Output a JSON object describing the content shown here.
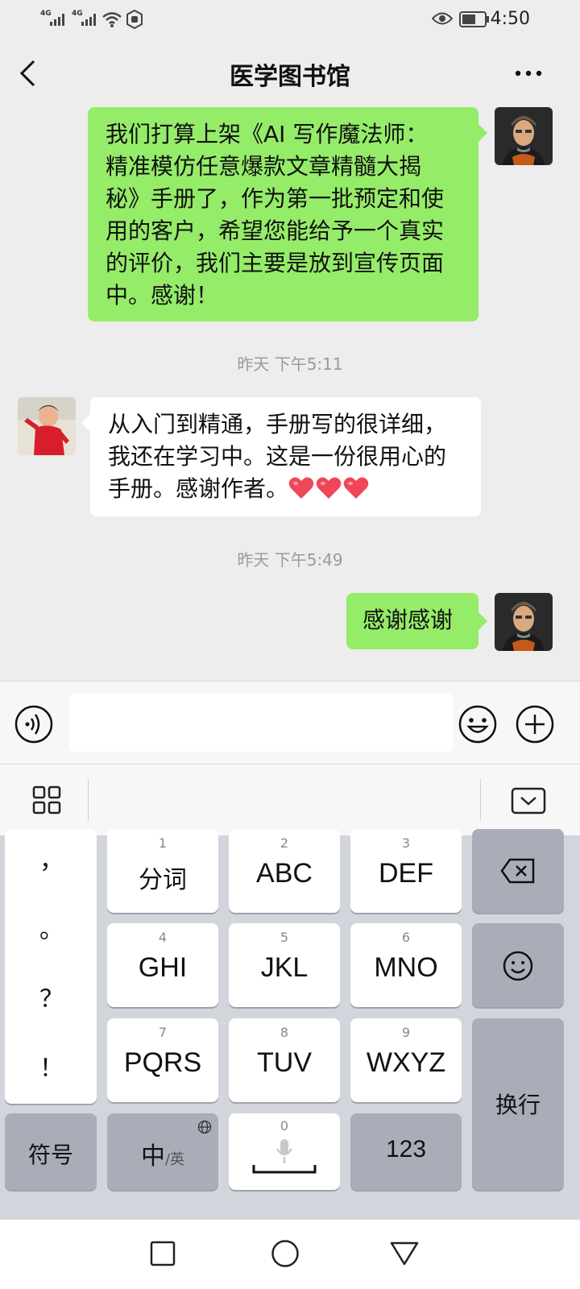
{
  "status_bar": {
    "signal_1": "4G",
    "signal_2": "4G",
    "time": "4:50",
    "icons": [
      "signal-icon",
      "signal-icon",
      "wifi-icon",
      "notification-icon",
      "eye-icon",
      "battery-icon"
    ]
  },
  "header": {
    "title": "医学图书馆",
    "back_icon": "chevron-left-icon",
    "more_icon": "more-icon"
  },
  "messages": [
    {
      "sender": "me",
      "lines": [
        "我们打算上架《AI 写作魔法师：",
        "精准模仿任意爆款文章精髓大揭",
        "秘》手册了，作为第一批预定和使",
        "用的客户，希望您能给予一个真实",
        "的评价，我们主要是放到宣传页面",
        "中。感谢！"
      ]
    },
    {
      "type": "timestamp",
      "text": "昨天 下午5:11"
    },
    {
      "sender": "other",
      "lines": [
        "从入门到精通，手册写的很详细，",
        "我还在学习中。这是一份很用心的",
        "手册。感谢作者。"
      ],
      "emoji_count": 3
    },
    {
      "type": "timestamp",
      "text": "昨天 下午5:49"
    },
    {
      "sender": "me",
      "lines": [
        "感谢感谢"
      ]
    }
  ],
  "input_bar": {
    "value": "",
    "placeholder": "",
    "icons": [
      "voice-icon",
      "emoji-icon",
      "plus-icon"
    ]
  },
  "keyboard_toolbar": {
    "icons": [
      "apps-grid-icon",
      "keyboard-hide-icon"
    ]
  },
  "keyboard": {
    "punctuation": [
      "，",
      "。",
      "？",
      "！"
    ],
    "keys": [
      {
        "num": "1",
        "label": "分词"
      },
      {
        "num": "2",
        "label": "ABC"
      },
      {
        "num": "3",
        "label": "DEF"
      },
      {
        "num": "4",
        "label": "GHI"
      },
      {
        "num": "5",
        "label": "JKL"
      },
      {
        "num": "6",
        "label": "MNO"
      },
      {
        "num": "7",
        "label": "PQRS"
      },
      {
        "num": "8",
        "label": "TUV"
      },
      {
        "num": "9",
        "label": "WXYZ"
      }
    ],
    "symbol_key": "符号",
    "lang_key_main": "中",
    "lang_key_sub": "/英",
    "space_num": "0",
    "num_key": "123",
    "enter_key": "换行",
    "icons": [
      "backspace-icon",
      "emoji-key-icon",
      "globe-icon",
      "microphone-icon"
    ]
  },
  "nav_bar": {
    "icons": [
      "recent-apps-icon",
      "home-icon",
      "back-icon"
    ]
  },
  "colors": {
    "my_bubble": "#95ec69",
    "other_bubble": "#ffffff",
    "background": "#ededed",
    "heart": "#f0465a"
  }
}
